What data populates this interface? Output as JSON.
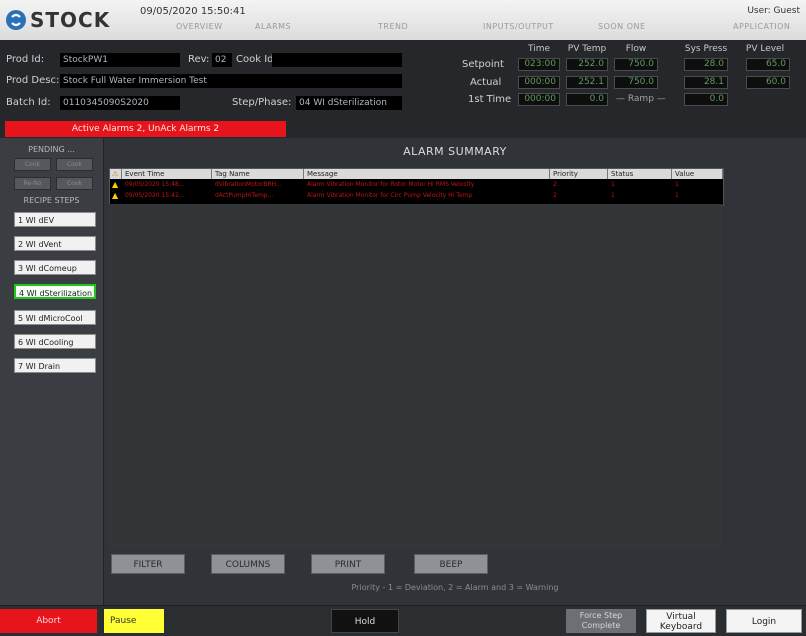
{
  "header": {
    "brand": "STOCK",
    "datetime": "09/05/2020 15:50:41",
    "user": "User: Guest",
    "tabs": [
      "OVERVIEW",
      "ALARMS",
      "TREND",
      "INPUTS/OUTPUT",
      "SOON ONE",
      "APPLICATION"
    ]
  },
  "info": {
    "prod_id_label": "Prod Id:",
    "prod_id": "StockPW1",
    "rev_label": "Rev:",
    "rev": "02",
    "cook_id_label": "Cook Id:",
    "cook_id": "",
    "prod_desc_label": "Prod Desc:",
    "prod_desc": "Stock Full Water Immersion Test",
    "batch_id_label": "Batch Id:",
    "batch_id": "0110345090S2020",
    "step_label": "Step/Phase:",
    "step": "04 WI dSterilization",
    "alarm_bar": "Active Alarms 2, UnAck Alarms 2"
  },
  "process": {
    "headers": [
      "Time",
      "PV Temp",
      "Flow",
      "Sys Press",
      "PV Level"
    ],
    "setpoint_label": "Setpoint",
    "actual_label": "Actual",
    "tot_time_label": "1st Time",
    "setpoint": [
      "023:00",
      "252.0",
      "750.0",
      "28.0",
      "65.0"
    ],
    "actual": [
      "000:00",
      "252.1",
      "750.0",
      "28.1",
      "60.0"
    ],
    "tot_time": "000:00",
    "tot_value": "0.0",
    "ramp_label": "— Ramp —",
    "ramp": "0.0"
  },
  "sidebar": {
    "pending_label": "PENDING ...",
    "buttons": [
      "Cook",
      "Cook",
      "Re-No",
      "Cook"
    ],
    "recipe_label": "RECIPE STEPS",
    "steps": [
      {
        "label": "1 WI dEV",
        "active": false
      },
      {
        "label": "2 WI dVent",
        "active": false
      },
      {
        "label": "3 WI dComeup",
        "active": false
      },
      {
        "label": "4 WI dSterilization",
        "active": true
      },
      {
        "label": "5 WI dMicroCool",
        "active": false
      },
      {
        "label": "6 WI dCooling",
        "active": false
      },
      {
        "label": "7 WI Drain",
        "active": false
      }
    ]
  },
  "summary": {
    "title": "ALARM SUMMARY",
    "columns": [
      "Event Time",
      "Tag Name",
      "Message",
      "Priority",
      "Status",
      "Value"
    ],
    "rows": [
      {
        "time": "09/05/2020 15:48...",
        "tag": "dVibrationMotorBRH...",
        "message": "Alarm Vibration Monitor for Rotor Motor Hi RMS Velocity",
        "priority": "2",
        "status": "1",
        "value": "1"
      },
      {
        "time": "09/05/2020 15:42...",
        "tag": "dActPumpHiTemp...",
        "message": "Alarm Vibration Monitor for Circ Pump Velocity Hi Temp",
        "priority": "2",
        "status": "1",
        "value": "1"
      }
    ],
    "buttons": [
      "FILTER",
      "COLUMNS",
      "PRINT",
      "BEEP"
    ],
    "legend": "Priority - 1 = Deviation, 2 = Alarm and 3 = Warning"
  },
  "footer": {
    "abort": "Abort",
    "pause": "Pause",
    "hold": "Hold",
    "force_step": "Force Step Complete",
    "virtual_keyboard": "Virtual Keyboard",
    "login": "Login"
  },
  "colors": {
    "alarm_red": "#e8141c",
    "active_green": "#1ec61e",
    "pause_yellow": "#ffff33",
    "brand_blue": "#2b6fb6"
  }
}
